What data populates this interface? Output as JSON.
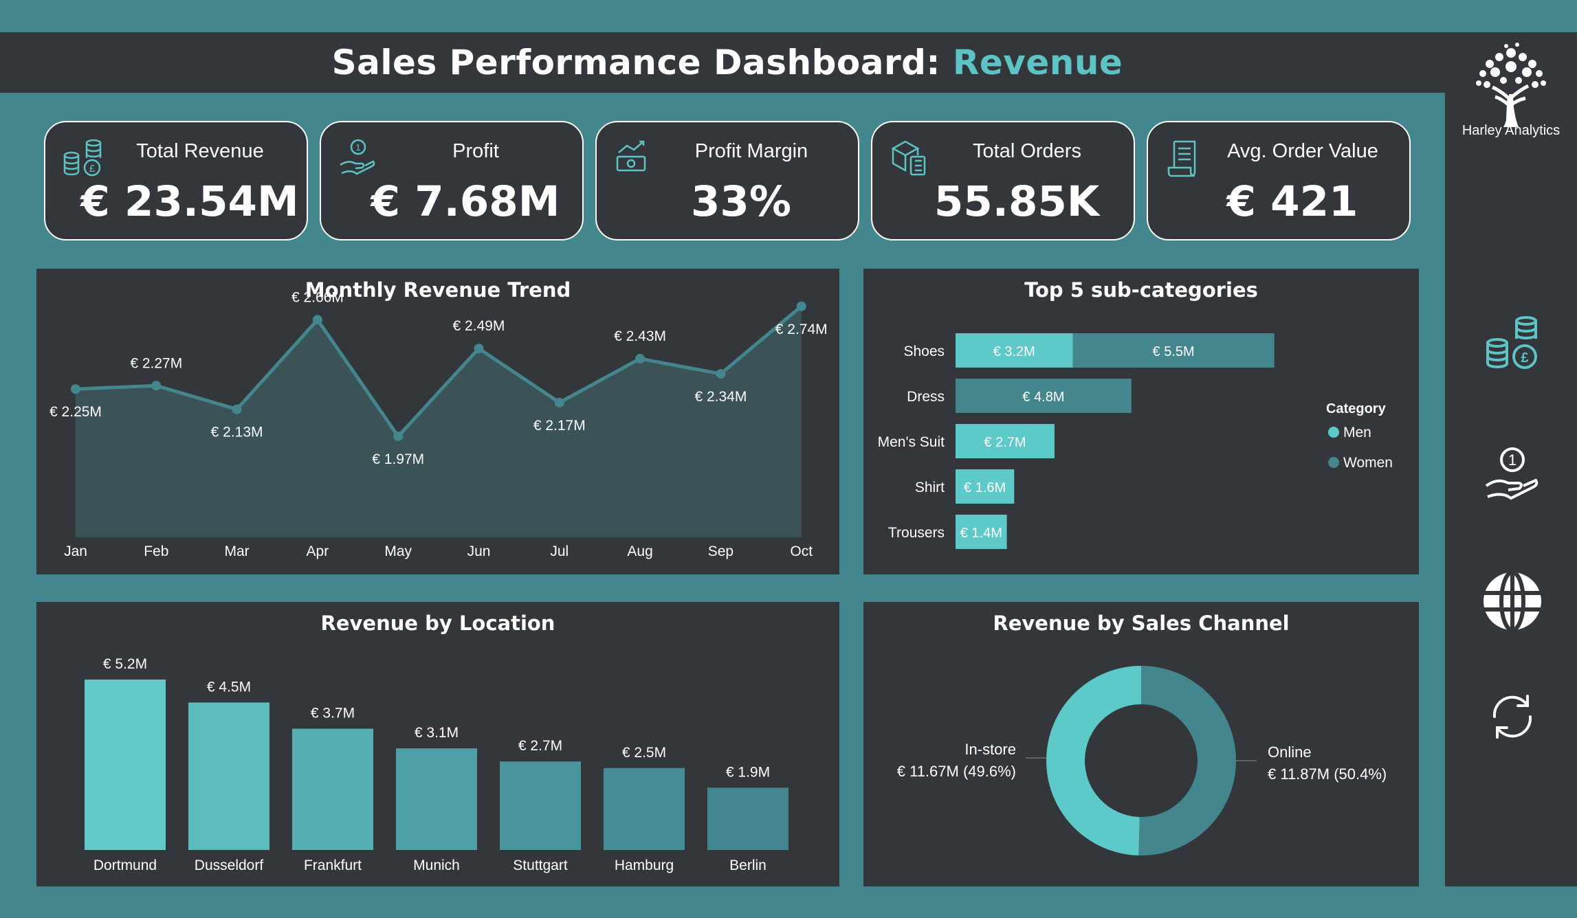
{
  "header": {
    "title_main": "Sales Performance Dashboard: ",
    "title_accent": "Revenue"
  },
  "brand": {
    "name": "Harley Analytics"
  },
  "sidebar": {
    "icons": [
      "coins-icon",
      "hand-coin-icon",
      "globe-icon",
      "refresh-icon"
    ]
  },
  "colors": {
    "background": "#43868e",
    "panel": "#33373b",
    "accent": "#5ec3c5",
    "men": "#5ec9c9",
    "women": "#43868e"
  },
  "kpis": [
    {
      "label": "Total Revenue",
      "value": "€ 23.54M",
      "icon": "coins-stack-icon"
    },
    {
      "label": "Profit",
      "value": "€ 7.68M",
      "icon": "hand-coin-icon"
    },
    {
      "label": "Profit Margin",
      "value": "33%",
      "icon": "banknote-trend-icon"
    },
    {
      "label": "Total Orders",
      "value": "55.85K",
      "icon": "package-list-icon"
    },
    {
      "label": "Avg. Order Value",
      "value": "€ 421",
      "icon": "receipt-icon"
    }
  ],
  "chart_data": [
    {
      "id": "monthly",
      "type": "area",
      "title": "Monthly Revenue Trend",
      "categories": [
        "Jan",
        "Feb",
        "Mar",
        "Apr",
        "May",
        "Jun",
        "Jul",
        "Aug",
        "Sep",
        "Oct"
      ],
      "values": [
        2.25,
        2.27,
        2.13,
        2.66,
        1.97,
        2.49,
        2.17,
        2.43,
        2.34,
        2.74
      ],
      "labels": [
        "€ 2.25M",
        "€ 2.27M",
        "€ 2.13M",
        "€ 2.66M",
        "€ 1.97M",
        "€ 2.49M",
        "€ 2.17M",
        "€ 2.43M",
        "€ 2.34M",
        "€ 2.74M"
      ],
      "ylim": [
        1.6,
        2.8
      ],
      "grid": false
    },
    {
      "id": "subcategories",
      "type": "bar",
      "orientation": "horizontal",
      "stacked": true,
      "title": "Top 5 sub-categories",
      "categories": [
        "Shoes",
        "Dress",
        "Men's Suit",
        "Shirt",
        "Trousers"
      ],
      "series": [
        {
          "name": "Men",
          "values": [
            3.2,
            0,
            2.7,
            1.6,
            1.4
          ],
          "labels": [
            "€ 3.2M",
            "",
            "€ 2.7M",
            "€ 1.6M",
            "€ 1.4M"
          ]
        },
        {
          "name": "Women",
          "values": [
            5.5,
            4.8,
            0,
            0,
            0
          ],
          "labels": [
            "€ 5.5M",
            "€ 4.8M",
            "",
            "",
            ""
          ]
        }
      ],
      "legend": {
        "title": "Category",
        "placement": "right"
      }
    },
    {
      "id": "location",
      "type": "bar",
      "title": "Revenue by Location",
      "categories": [
        "Dortmund",
        "Dusseldorf",
        "Frankfurt",
        "Munich",
        "Stuttgart",
        "Hamburg",
        "Berlin"
      ],
      "values": [
        5.2,
        4.5,
        3.7,
        3.1,
        2.7,
        2.5,
        1.9
      ],
      "labels": [
        "€ 5.2M",
        "€ 4.5M",
        "€ 3.7M",
        "€ 3.1M",
        "€ 2.7M",
        "€ 2.5M",
        "€ 1.9M"
      ],
      "colors": [
        "#62cbca",
        "#5cbcbd",
        "#55aeb1",
        "#4fa0a6",
        "#4a959c",
        "#468d95",
        "#438690"
      ]
    },
    {
      "id": "channel",
      "type": "pie",
      "donut": true,
      "title": "Revenue by Sales Channel",
      "slices": [
        {
          "name": "Online",
          "value": 11.87,
          "label": "€ 11.87M (50.4%)",
          "color": "#43868e"
        },
        {
          "name": "In-store",
          "value": 11.67,
          "label": "€ 11.67M (49.6%)",
          "color": "#5ec9c9"
        }
      ]
    }
  ]
}
